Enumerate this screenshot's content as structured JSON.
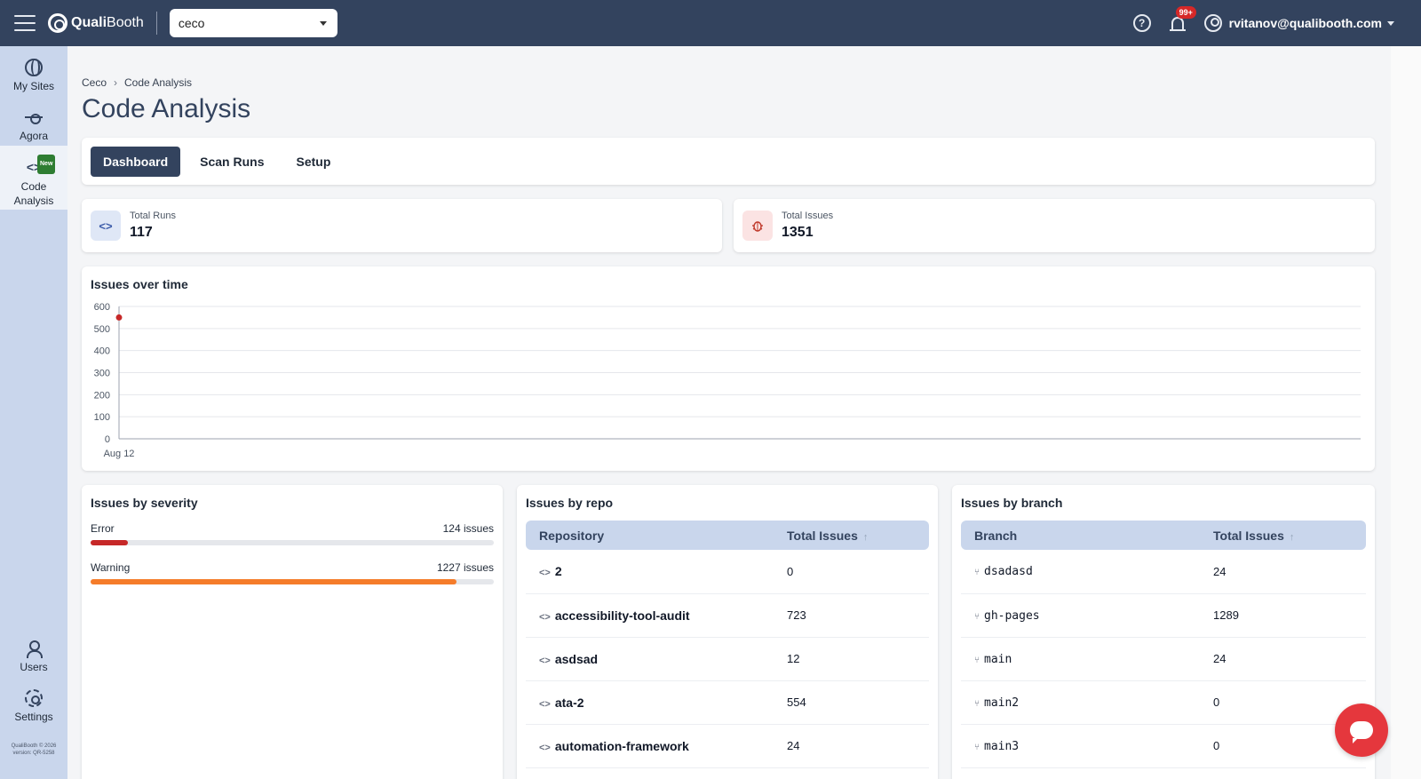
{
  "topbar": {
    "logo_bold": "Quali",
    "logo_light": "Booth",
    "site_select": "ceco",
    "notification_badge": "99+",
    "user_email": "rvitanov@qualibooth.com",
    "help_glyph": "?"
  },
  "sidebar": {
    "items": [
      {
        "label": "My Sites",
        "icon": "globe-icon"
      },
      {
        "label": "Agora",
        "icon": "hub-icon"
      },
      {
        "label": "Code\nAnalysis",
        "icon": "code-icon",
        "tag": "New"
      }
    ],
    "bottom_items": [
      {
        "label": "Users",
        "icon": "users-icon"
      },
      {
        "label": "Settings",
        "icon": "gear-icon"
      }
    ],
    "copyright": "QualiBooth © 2026",
    "version": "version: QR-5258"
  },
  "breadcrumb": [
    "Ceco",
    "Code Analysis"
  ],
  "page_title": "Code Analysis",
  "tabs": [
    {
      "label": "Dashboard",
      "active": true
    },
    {
      "label": "Scan Runs",
      "active": false
    },
    {
      "label": "Setup",
      "active": false
    }
  ],
  "stats": [
    {
      "label": "Total Runs",
      "value": "117",
      "icon": "code-icon"
    },
    {
      "label": "Total Issues",
      "value": "1351",
      "icon": "bug-icon"
    }
  ],
  "issues_over_time": {
    "title": "Issues over time"
  },
  "chart_data": {
    "type": "scatter",
    "title": "Issues over time",
    "x": [
      "Aug 12"
    ],
    "values": [
      550
    ],
    "yticks": [
      0,
      100,
      200,
      300,
      400,
      500,
      600
    ],
    "ylim": [
      0,
      600
    ],
    "grid": true,
    "point_color": "#c62828"
  },
  "severity": {
    "title": "Issues by severity",
    "items": [
      {
        "label": "Error",
        "count": "124 issues",
        "fraction": 0.092,
        "color": "#c62828"
      },
      {
        "label": "Warning",
        "count": "1227 issues",
        "fraction": 0.908,
        "color": "#f57c2a"
      }
    ]
  },
  "repos": {
    "title": "Issues by repo",
    "columns": [
      "Repository",
      "Total Issues"
    ],
    "rows": [
      {
        "name": "2",
        "total": "0"
      },
      {
        "name": "accessibility-tool-audit",
        "total": "723"
      },
      {
        "name": "asdsad",
        "total": "12"
      },
      {
        "name": "ata-2",
        "total": "554"
      },
      {
        "name": "automation-framework",
        "total": "24"
      }
    ]
  },
  "branches": {
    "title": "Issues by branch",
    "columns": [
      "Branch",
      "Total Issues"
    ],
    "rows": [
      {
        "name": "dsadasd",
        "total": "24"
      },
      {
        "name": "gh-pages",
        "total": "1289"
      },
      {
        "name": "main",
        "total": "24"
      },
      {
        "name": "main2",
        "total": "0"
      },
      {
        "name": "main3",
        "total": "0"
      }
    ]
  },
  "glyphs": {
    "code": "<>",
    "sort": "↑",
    "branch": "⑂"
  }
}
